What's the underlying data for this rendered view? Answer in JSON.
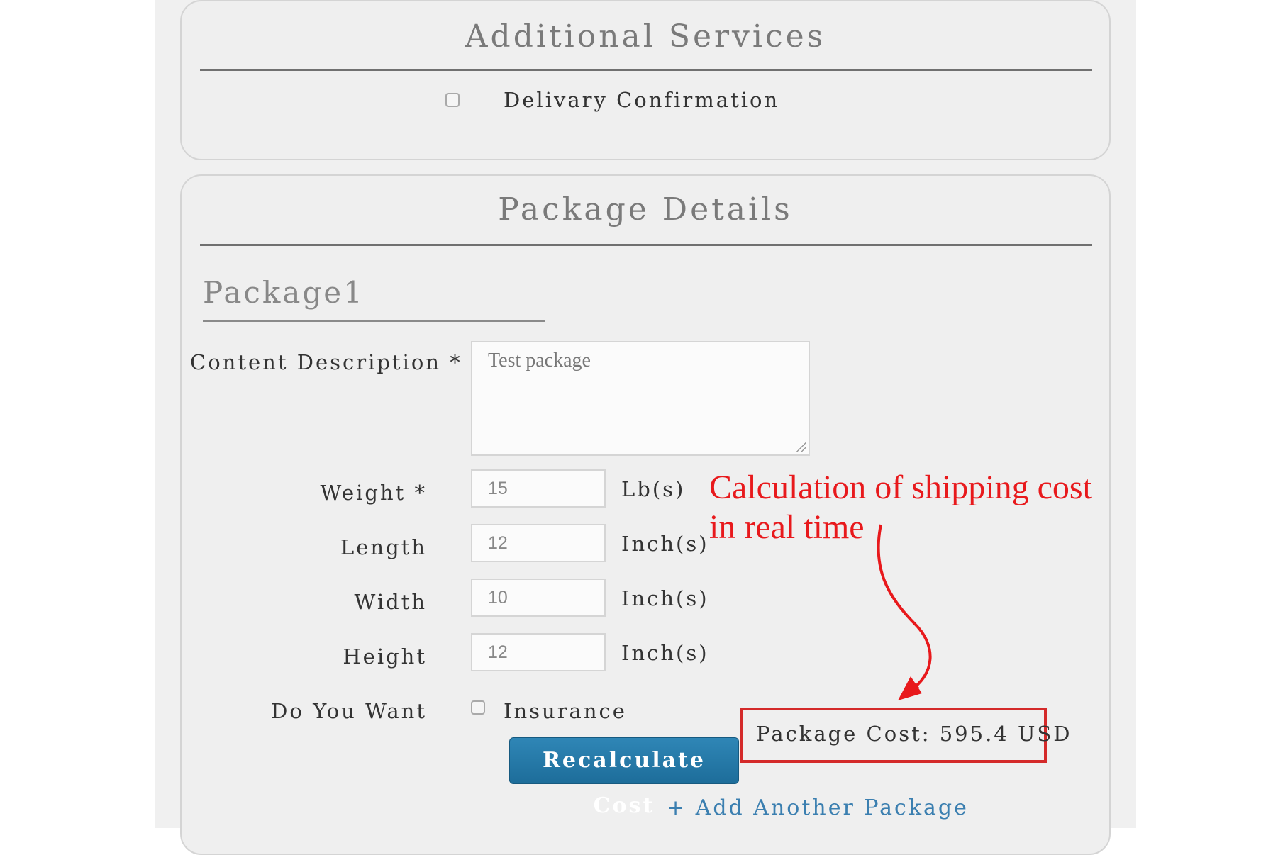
{
  "additional_services": {
    "title": "Additional Services",
    "delivery_confirmation_label": "Delivary Confirmation"
  },
  "package_details": {
    "title": "Package Details",
    "package_heading": "Package1",
    "content_description_label": "Content Description *",
    "content_description_value": "Test package",
    "weight_label": "Weight *",
    "weight_value": "15",
    "weight_unit": "Lb(s)",
    "length_label": "Length",
    "length_value": "12",
    "length_unit": "Inch(s)",
    "width_label": "Width",
    "width_value": "10",
    "width_unit": "Inch(s)",
    "height_label": "Height",
    "height_value": "12",
    "height_unit": "Inch(s)",
    "do_you_want_label": "Do You Want",
    "insurance_label": "Insurance",
    "recalculate_button": "Recalculate Cost",
    "package_cost": "Package Cost: 595.4 USD",
    "add_package_link": "+ Add Another Package"
  },
  "annotation": {
    "line1": "Calculation of shipping cost",
    "line2": "in real time",
    "color": "#e8191c"
  }
}
